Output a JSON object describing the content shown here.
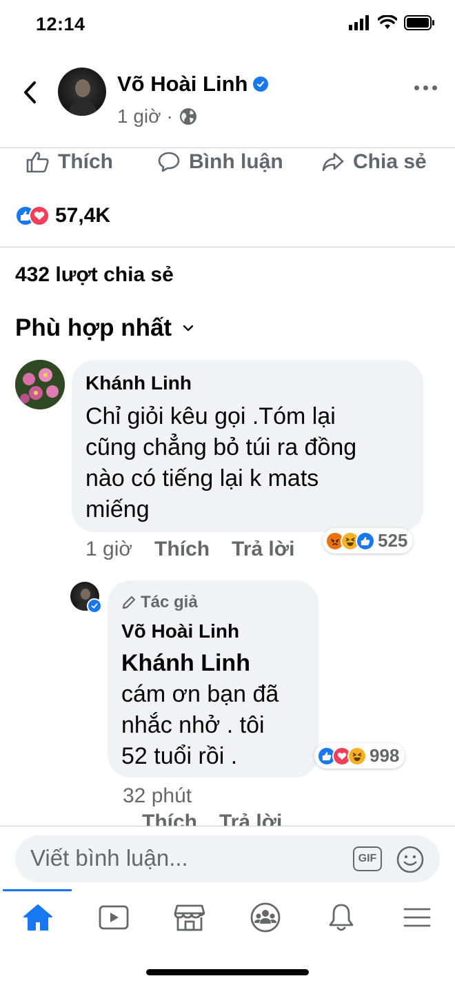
{
  "status_bar": {
    "time": "12:14"
  },
  "post": {
    "author": "Võ Hoài Linh",
    "time": "1 giờ",
    "separator": "·",
    "actions": {
      "like": "Thích",
      "comment": "Bình luận",
      "share": "Chia sẻ"
    },
    "reaction_count": "57,4K",
    "shares": "432 lượt chia sẻ"
  },
  "sort": {
    "label": "Phù hợp nhất"
  },
  "comments": [
    {
      "name": "Khánh Linh",
      "text": [
        "Chỉ giỏi kêu gọi .Tóm lại",
        "cũng chẳng bỏ túi ra đồng",
        "nào có tiếng lại k mats",
        "miếng"
      ],
      "time": "1 giờ",
      "like": "Thích",
      "reply": "Trả lời",
      "reactions": [
        "angry",
        "haha",
        "like"
      ],
      "reaction_count": "525"
    },
    {
      "badge": "Tác giả",
      "name": "Võ Hoài Linh",
      "mention": "Khánh Linh",
      "text": [
        "cám ơn bạn đã",
        "nhắc nhở . tôi",
        "52 tuổi rồi ."
      ],
      "time": "32 phút",
      "like": "Thích",
      "reply": "Trả lời",
      "reactions": [
        "like",
        "love",
        "haha"
      ],
      "reaction_count": "998"
    }
  ],
  "composer": {
    "placeholder": "Viết bình luận...",
    "gif": "GIF"
  },
  "tabs": [
    "home-icon",
    "watch-icon",
    "marketplace-icon",
    "groups-icon",
    "notifications-icon",
    "menu-icon"
  ],
  "colors": {
    "brand": "#1877f2",
    "love": "#f33e58",
    "haha": "#f7b125",
    "angry": "#e9710f",
    "secondary_text": "#65676b"
  }
}
